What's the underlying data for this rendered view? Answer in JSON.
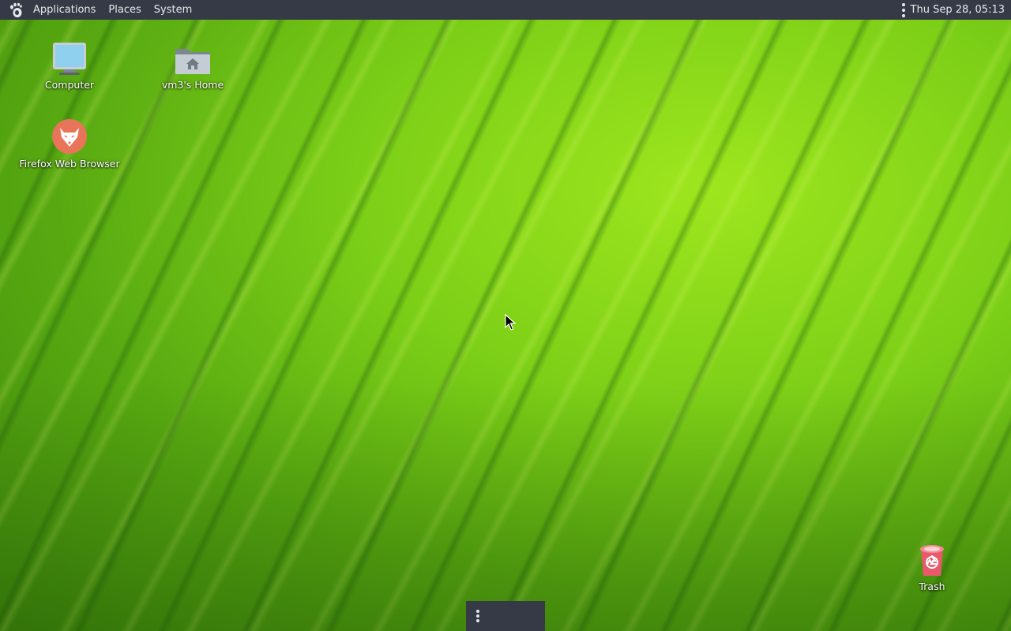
{
  "panel": {
    "menu": {
      "applications": "Applications",
      "places": "Places",
      "system": "System"
    },
    "clock": "Thu Sep 28, 05:13",
    "logo_icon": "gnome-foot-icon",
    "handle_icon": "vertical-dots-icon"
  },
  "desktop": {
    "icons": {
      "computer": {
        "label": "Computer",
        "icon": "monitor-icon"
      },
      "home": {
        "label": "vm3's Home",
        "icon": "home-folder-icon"
      },
      "firefox": {
        "label": "Firefox Web Browser",
        "icon": "firefox-icon"
      },
      "trash": {
        "label": "Trash",
        "icon": "trash-icon"
      }
    }
  },
  "bottom_panel": {
    "handle_icon": "vertical-dots-icon"
  },
  "colors": {
    "panel_bg": "#353a46",
    "panel_text": "#e6e8ec",
    "wallpaper_green": "#7ccf17",
    "firefox_accent": "#e8755a",
    "trash_accent": "#e85a6a"
  }
}
